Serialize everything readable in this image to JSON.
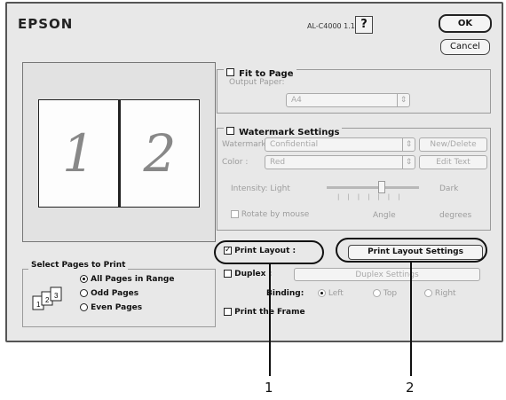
{
  "header": {
    "brand": "EPSON",
    "model": "AL-C4000 1.1E",
    "help": "?",
    "ok": "OK",
    "cancel": "Cancel"
  },
  "preview": {
    "page1": "1",
    "page2": "2"
  },
  "fit_to_page": {
    "label": "Fit to Page",
    "output_paper_label": "Output Paper:",
    "output_paper_value": "A4"
  },
  "watermark": {
    "label": "Watermark Settings",
    "watermark_label": "Watermark:",
    "watermark_value": "Confidential",
    "new_delete": "New/Delete",
    "color_label": "Color :",
    "color_value": "Red",
    "edit_text": "Edit Text",
    "intensity_label": "Intensity: Light",
    "intensity_dark": "Dark",
    "rotate_label": "Rotate by mouse",
    "angle_label": "Angle",
    "degrees_label": "degrees"
  },
  "select_pages": {
    "title": "Select Pages to Print",
    "options": [
      "All Pages in Range",
      "Odd Pages",
      "Even Pages"
    ]
  },
  "print_layout": {
    "label": "Print Layout :",
    "settings_button": "Print Layout Settings"
  },
  "duplex": {
    "label": "Duplex :",
    "settings_button": "Duplex Settings",
    "binding_label": "Binding:",
    "left": "Left",
    "top": "Top",
    "right": "Right"
  },
  "print_frame": {
    "label": "Print the Frame"
  },
  "callouts": {
    "one": "1",
    "two": "2"
  }
}
